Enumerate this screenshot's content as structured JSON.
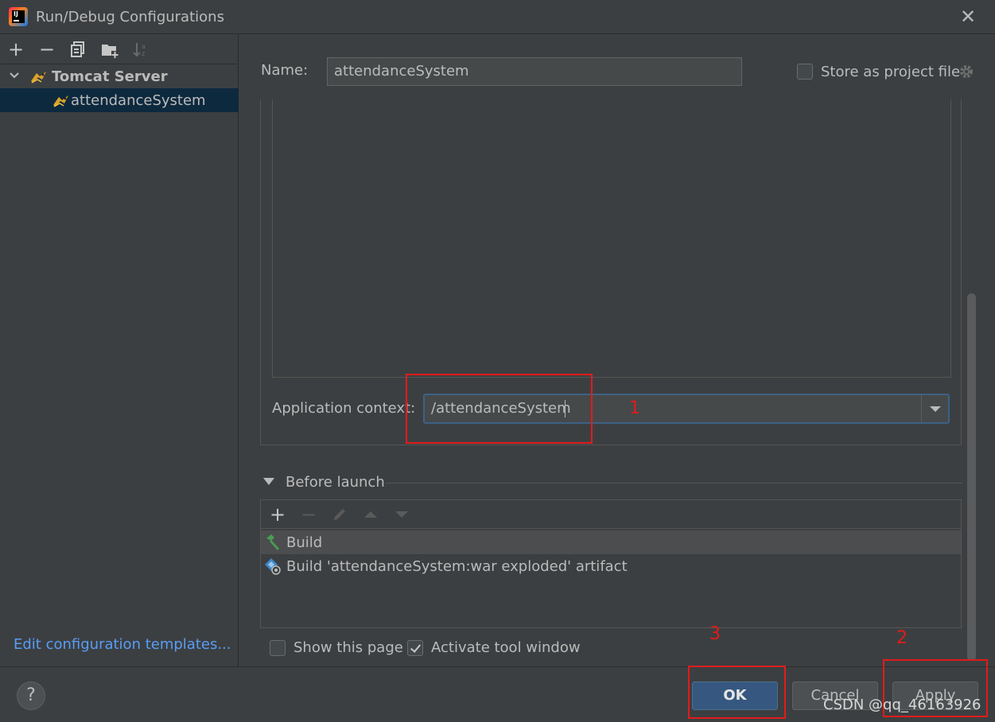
{
  "window": {
    "title": "Run/Debug Configurations"
  },
  "left_toolbar": {
    "icons": [
      "add-icon",
      "remove-icon",
      "copy-icon",
      "folder-add-icon",
      "sort-icon"
    ]
  },
  "tree": {
    "group_label": "Tomcat Server",
    "item_label": "attendanceSystem"
  },
  "edit_templates_link": "Edit configuration templates...",
  "form": {
    "name_label": "Name:",
    "name_value": "attendanceSystem",
    "store_as_project_file_label": "Store as project file",
    "store_as_project_file_checked": false,
    "application_context_label": "Application context:",
    "application_context_value": "/attendanceSystem"
  },
  "before_launch": {
    "title": "Before launch",
    "items": [
      {
        "label": "Build",
        "icon": "hammer-icon"
      },
      {
        "label": "Build 'attendanceSystem:war exploded' artifact",
        "icon": "artifact-icon"
      }
    ]
  },
  "options": {
    "show_this_page_label": "Show this page",
    "show_this_page_checked": false,
    "activate_tool_window_label": "Activate tool window",
    "activate_tool_window_checked": true
  },
  "buttons": {
    "help": "?",
    "ok": "OK",
    "cancel": "Cancel",
    "apply": "Apply"
  },
  "annotations": {
    "marker_1": "1",
    "marker_2": "2",
    "marker_3": "3",
    "color": "#e21b1b"
  },
  "watermark": "CSDN @qq_46163926",
  "colors": {
    "background": "#3c3f41",
    "selection": "#0d293e",
    "link": "#589df6",
    "primary_button": "#365880"
  }
}
